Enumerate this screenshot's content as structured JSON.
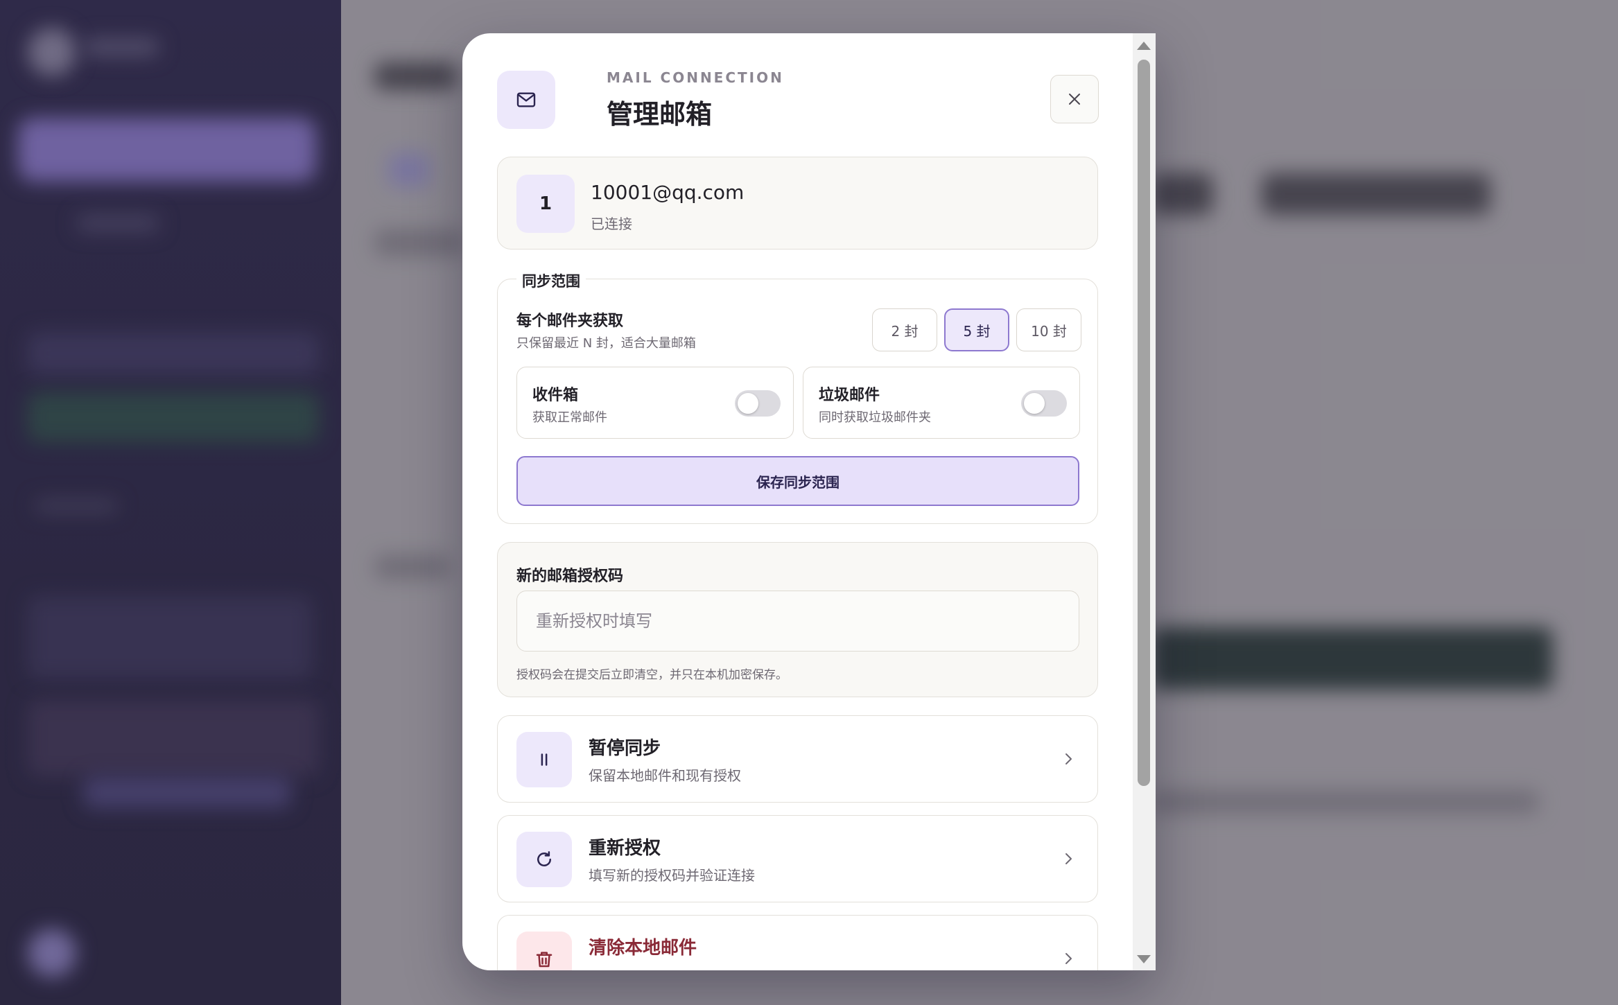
{
  "modal": {
    "eyebrow": "MAIL CONNECTION",
    "title": "管理邮箱",
    "header_icon": "mail-icon",
    "close_icon": "close-icon"
  },
  "account": {
    "number": "1",
    "email": "10001@qq.com",
    "status": "已连接"
  },
  "sync": {
    "legend": "同步范围",
    "per_folder_label": "每个邮件夹获取",
    "per_folder_hint": "只保留最近 N 封，适合大量邮箱",
    "options": [
      "2 封",
      "5 封",
      "10 封"
    ],
    "selected": "5 封",
    "inbox": {
      "title": "收件箱",
      "subtitle": "获取正常邮件",
      "enabled": false
    },
    "spam": {
      "title": "垃圾邮件",
      "subtitle": "同时获取垃圾邮件夹",
      "enabled": false
    },
    "save_label": "保存同步范围"
  },
  "auth": {
    "label": "新的邮箱授权码",
    "placeholder": "重新授权时填写",
    "value": "",
    "hint": "授权码会在提交后立即清空，并只在本机加密保存。"
  },
  "actions": [
    {
      "icon": "pause-icon",
      "title": "暂停同步",
      "subtitle": "保留本地邮件和现有授权"
    },
    {
      "icon": "refresh-icon",
      "title": "重新授权",
      "subtitle": "填写新的授权码并验证连接"
    },
    {
      "icon": "trash-icon",
      "title": "清除本地邮件",
      "subtitle": ""
    }
  ],
  "colors": {
    "accent": "#8d78cf",
    "accent_soft": "#ede8fb",
    "danger": "#8a2a37",
    "danger_soft": "#fde7ea",
    "sidebar_bg": "#1f1a3d"
  }
}
